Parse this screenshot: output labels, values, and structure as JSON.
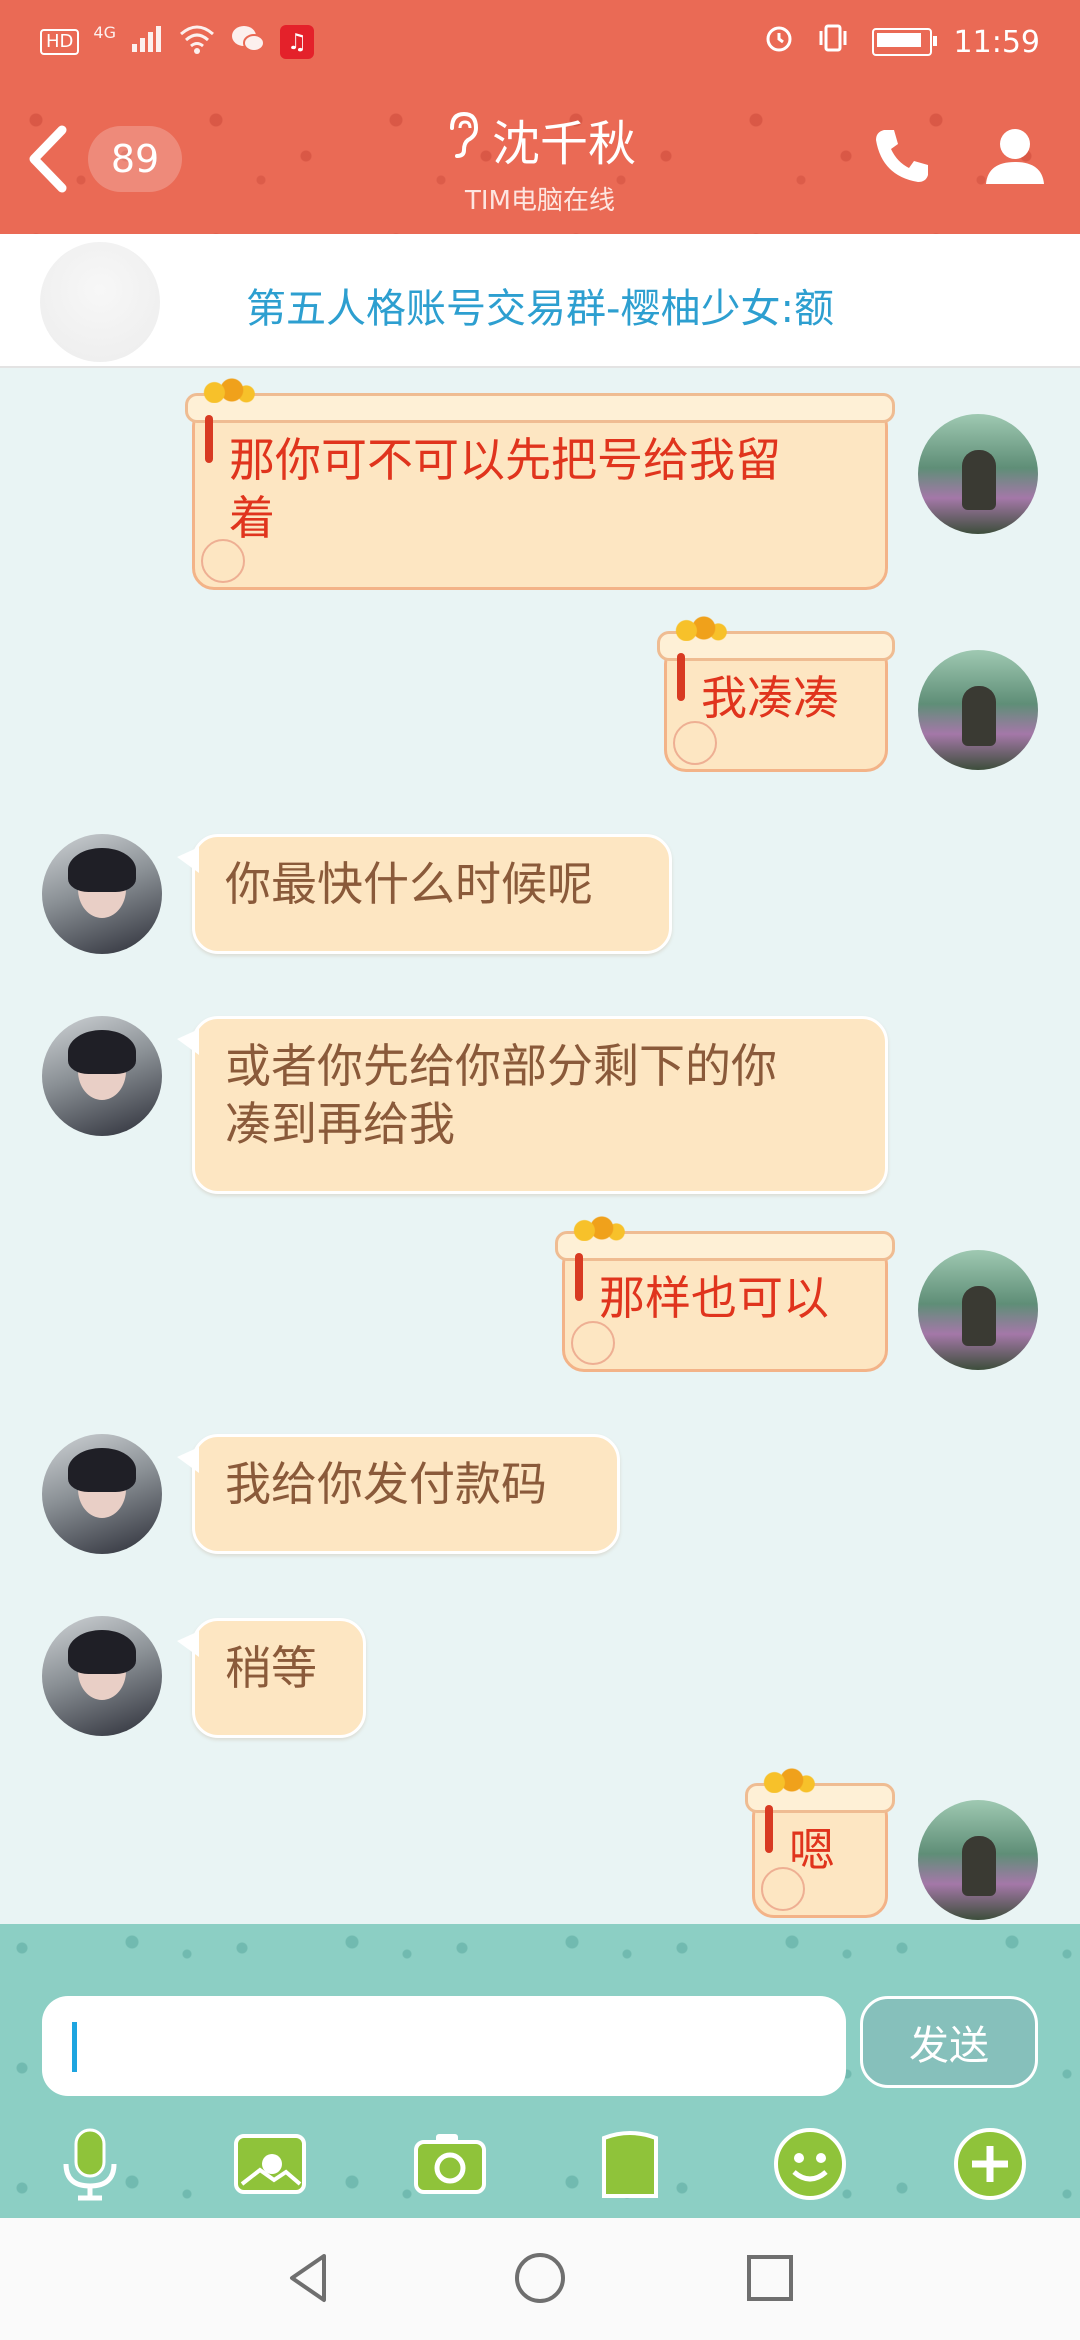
{
  "status_bar": {
    "hd": "HD",
    "network": "4G",
    "time": "11:59"
  },
  "header": {
    "unread_count": "89",
    "title": "沈千秋",
    "subtitle": "TIM电脑在线",
    "icons": {
      "back": "chevron-left-icon",
      "ear": "ear-icon",
      "phone": "phone-icon",
      "profile": "user-icon"
    }
  },
  "notice": {
    "text": "第五人格账号交易群-樱柚少女:额"
  },
  "messages": [
    {
      "from": "me",
      "text_line1": "那你可不可以先把号给我留",
      "text_line2": "着"
    },
    {
      "from": "me",
      "text": "我凑凑"
    },
    {
      "from": "other",
      "text": "你最快什么时候呢"
    },
    {
      "from": "other",
      "text_line1": "或者你先给你部分剩下的你",
      "text_line2": "凑到再给我"
    },
    {
      "from": "me",
      "text": "那样也可以"
    },
    {
      "from": "other",
      "text": "我给你发付款码"
    },
    {
      "from": "other",
      "text": "稍等"
    },
    {
      "from": "me",
      "text": "嗯"
    }
  ],
  "input": {
    "value": "",
    "send_label": "发送"
  },
  "toolbar": [
    "microphone-icon",
    "image-icon",
    "camera-icon",
    "file-icon",
    "emoji-icon",
    "plus-icon"
  ],
  "colors": {
    "header": "#ea6a55",
    "input_area": "#8ccfc4",
    "bubble": "#fde6c2",
    "my_text": "#e0341d",
    "their_text": "#8a5a3a",
    "notice_text": "#2d9fd0"
  }
}
